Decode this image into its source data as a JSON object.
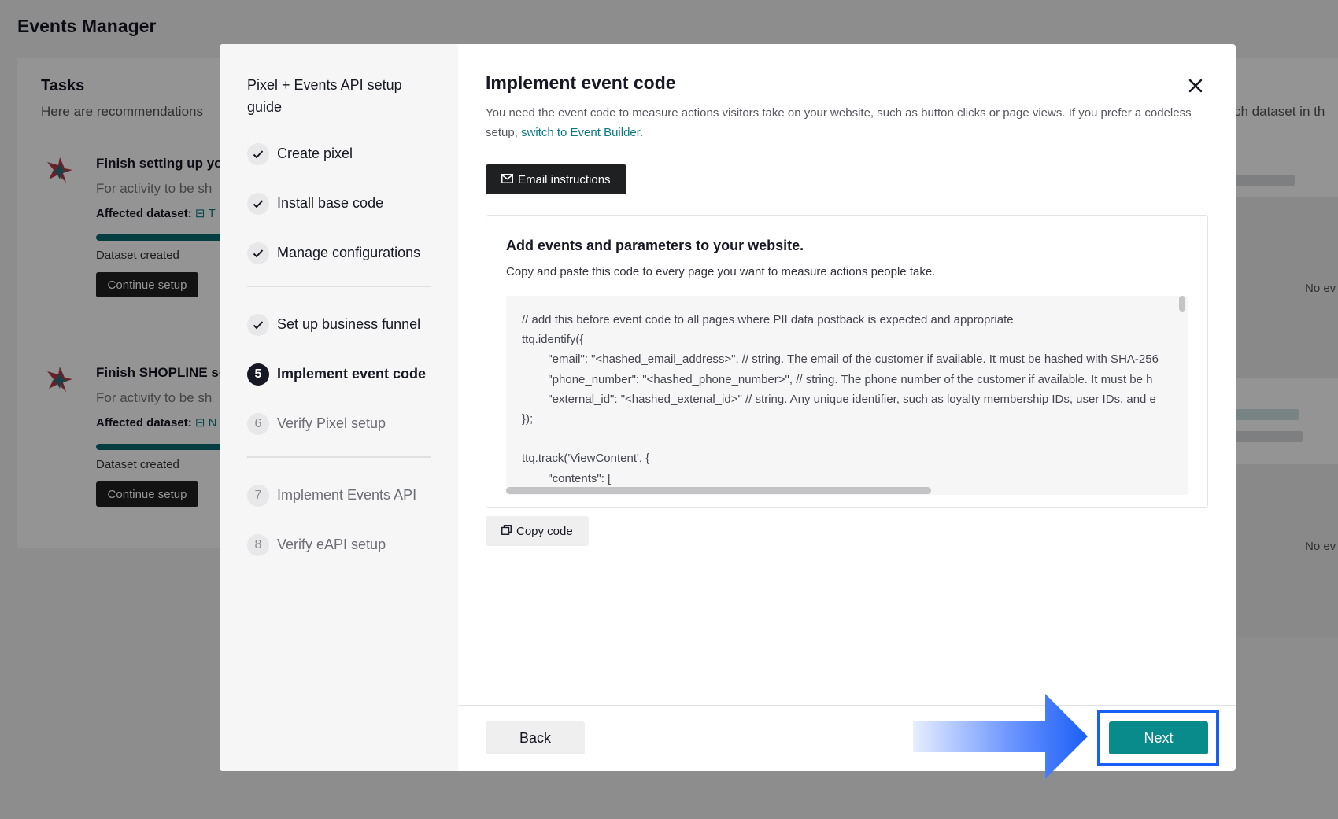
{
  "background": {
    "app_title": "Events Manager",
    "tasks_title": "Tasks",
    "tasks_subtitle": "Here are recommendations",
    "tasks_subtitle_right": "ch dataset in th",
    "tasks": [
      {
        "title": "Finish setting up yo",
        "desc": "For activity to be sh",
        "affected_label": "Affected dataset:",
        "affected_value": "T",
        "status": "Dataset created",
        "button": "Continue setup"
      },
      {
        "title": "Finish SHOPLINE se",
        "desc": "For activity to be sh",
        "affected_label": "Affected dataset:",
        "affected_value": "N",
        "status": "Dataset created",
        "button": "Continue setup"
      }
    ],
    "no_events_1": "No ev",
    "no_events_2": "No ev"
  },
  "sidebar": {
    "title": "Pixel + Events API setup guide",
    "steps": [
      {
        "label": "Create pixel",
        "state": "done",
        "marker": ""
      },
      {
        "label": "Install base code",
        "state": "done",
        "marker": ""
      },
      {
        "label": "Manage configurations",
        "state": "done",
        "marker": ""
      },
      {
        "label": "Set up business funnel",
        "state": "done",
        "marker": ""
      },
      {
        "label": "Implement event code",
        "state": "active",
        "marker": "5"
      },
      {
        "label": "Verify Pixel setup",
        "state": "todo",
        "marker": "6"
      },
      {
        "label": "Implement Events API",
        "state": "todo",
        "marker": "7"
      },
      {
        "label": "Verify eAPI setup",
        "state": "todo",
        "marker": "8"
      }
    ]
  },
  "main": {
    "title": "Implement event code",
    "description": "You need the event code to measure actions visitors take on your website, such as button clicks or page views. If you prefer a codeless setup, ",
    "description_link": "switch to Event Builder.",
    "email_button": "Email instructions",
    "card_heading": "Add events and parameters to your website.",
    "card_subtext": "Copy and paste this code to every page you want to measure actions people take.",
    "code_lines": [
      "// add this before event code to all pages where PII data postback is expected and appropriate",
      "ttq.identify({",
      "        \"email\": \"<hashed_email_address>\", // string. The email of the customer if available. It must be hashed with SHA-256",
      "        \"phone_number\": \"<hashed_phone_number>\", // string. The phone number of the customer if available. It must be h",
      "        \"external_id\": \"<hashed_extenal_id>\" // string. Any unique identifier, such as loyalty membership IDs, user IDs, and e",
      "});",
      "",
      "ttq.track('ViewContent', {",
      "        \"contents\": ["
    ],
    "copy_button": "Copy code"
  },
  "footer": {
    "back_label": "Back",
    "next_label": "Next"
  },
  "colors": {
    "accent": "#098b8b",
    "highlight": "#1a5ff5"
  }
}
